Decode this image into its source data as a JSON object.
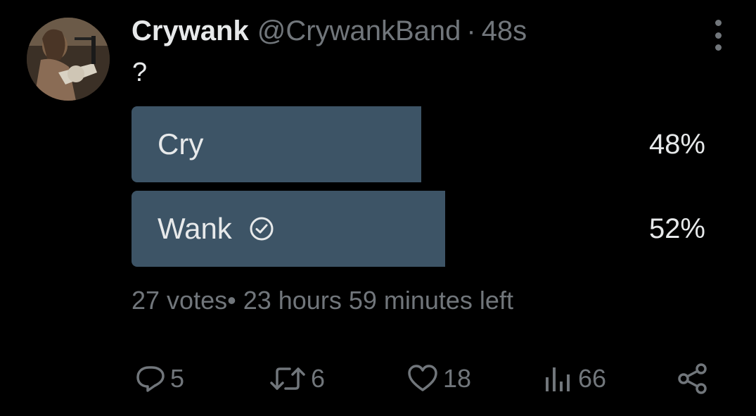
{
  "tweet": {
    "display_name": "Crywank",
    "handle": "@CrywankBand",
    "separator": "·",
    "time": "48s",
    "text": "?"
  },
  "poll": {
    "options": [
      {
        "label": "Cry",
        "percent_text": "48%",
        "percent": 48,
        "selected": false
      },
      {
        "label": "Wank",
        "percent_text": "52%",
        "percent": 52,
        "selected": true
      }
    ],
    "votes_text": "27 votes",
    "separator": "•",
    "time_left": "23 hours 59 minutes left"
  },
  "actions": {
    "replies": "5",
    "retweets": "6",
    "likes": "18",
    "views": "66"
  },
  "icons": {
    "more": "more-vertical-icon",
    "check": "check-circle-icon",
    "reply": "reply-icon",
    "retweet": "retweet-icon",
    "like": "heart-icon",
    "views": "views-icon",
    "share": "share-icon"
  },
  "colors": {
    "background": "#000000",
    "text_primary": "#e7e9ea",
    "text_secondary": "#71767b",
    "poll_bar": "#3d5466"
  }
}
